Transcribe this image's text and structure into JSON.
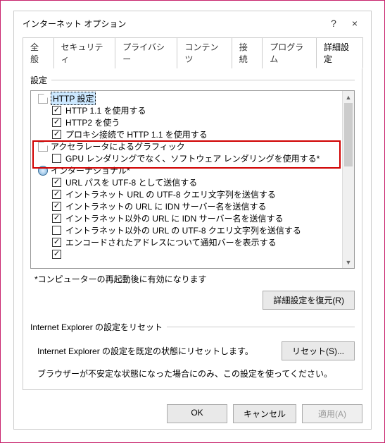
{
  "window": {
    "title": "インターネット オプション",
    "help": "?",
    "close": "×"
  },
  "tabs": [
    "全般",
    "セキュリティ",
    "プライバシー",
    "コンテンツ",
    "接続",
    "プログラム",
    "詳細設定"
  ],
  "activeTab": 6,
  "settings": {
    "label": "設定",
    "groups": [
      {
        "icon": "doc",
        "label": "HTTP 設定",
        "selected": true,
        "items": [
          {
            "checked": true,
            "label": "HTTP 1.1 を使用する"
          },
          {
            "checked": true,
            "label": "HTTP2 を使う"
          },
          {
            "checked": true,
            "label": "プロキシ接続で HTTP 1.1 を使用する"
          }
        ]
      },
      {
        "icon": "doc",
        "label": "アクセラレータによるグラフィック",
        "callout": true,
        "items": [
          {
            "checked": false,
            "label": "GPU レンダリングでなく、ソフトウェア レンダリングを使用する*"
          }
        ]
      },
      {
        "icon": "globe",
        "label": "インターナショナル*",
        "items": [
          {
            "checked": true,
            "label": "URL パスを UTF-8 として送信する"
          },
          {
            "checked": true,
            "label": "イントラネット URL の UTF-8 クエリ文字列を送信する"
          },
          {
            "checked": true,
            "label": "イントラネットの URL に IDN サーバー名を送信する"
          },
          {
            "checked": true,
            "label": "イントラネット以外の URL に IDN サーバー名を送信する"
          },
          {
            "checked": false,
            "label": "イントラネット以外の URL の UTF-8 クエリ文字列を送信する"
          },
          {
            "checked": true,
            "label": "エンコードされたアドレスについて通知バーを表示する"
          },
          {
            "checked": true,
            "label": ""
          }
        ]
      }
    ],
    "note": "*コンピューターの再起動後に有効になります",
    "restoreBtn": "詳細設定を復元(R)"
  },
  "reset": {
    "sectionLabel": "Internet Explorer の設定をリセット",
    "desc": "Internet Explorer の設定を既定の状態にリセットします。",
    "btn": "リセット(S)...",
    "warn": "ブラウザーが不安定な状態になった場合にのみ、この設定を使ってください。"
  },
  "footer": {
    "ok": "OK",
    "cancel": "キャンセル",
    "apply": "適用(A)"
  }
}
